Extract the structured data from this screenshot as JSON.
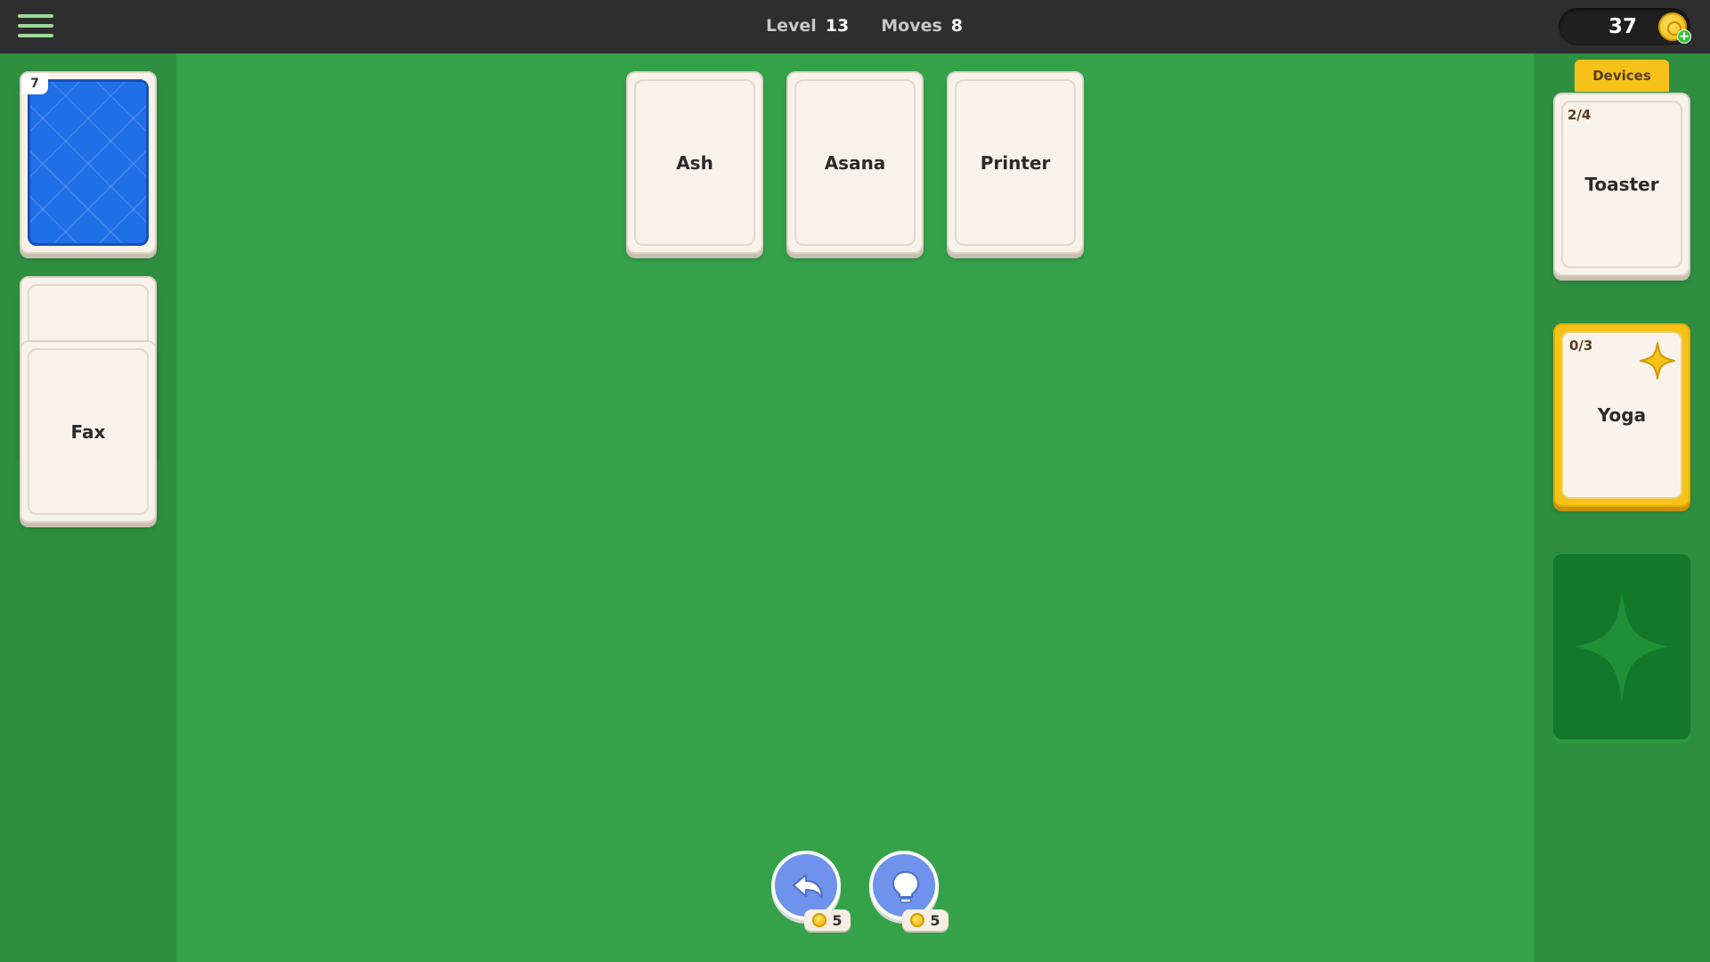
{
  "topbar": {
    "level_label": "Level",
    "level_value": "13",
    "moves_label": "Moves",
    "moves_value": "8",
    "coins": "37"
  },
  "deck": {
    "count": "7"
  },
  "waste": {
    "top_card": "Fax"
  },
  "tableau": [
    {
      "label": "Ash"
    },
    {
      "label": "Asana"
    },
    {
      "label": "Printer"
    }
  ],
  "foundations": [
    {
      "category": "Devices",
      "progress": "2/4",
      "card": "Toaster",
      "style": "white"
    },
    {
      "progress": "0/3",
      "card": "Yoga",
      "style": "gold"
    }
  ],
  "actions": {
    "undo_cost": "5",
    "hint_cost": "5"
  },
  "colors": {
    "table": "#35a24a",
    "panel": "#2f8f40",
    "gold": "#f6c21a",
    "deck_blue": "#1f6fe6",
    "button_blue": "#6f93ec"
  },
  "icons": [
    "menu-icon",
    "coin-icon",
    "plus-icon",
    "star-icon",
    "undo-icon",
    "lightbulb-icon"
  ]
}
